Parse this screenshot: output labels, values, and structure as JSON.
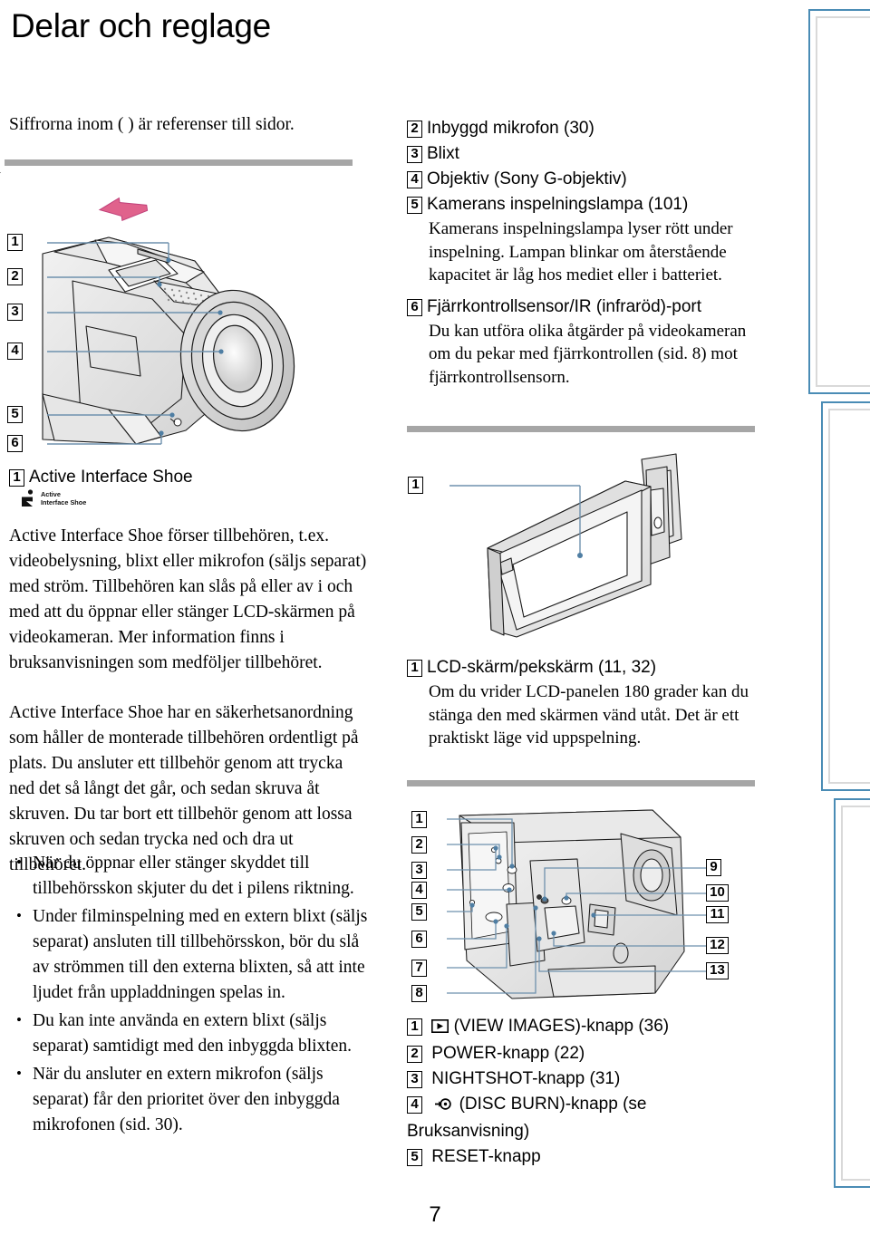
{
  "page": {
    "title": "Delar och reglage",
    "intro": "Siffrorna inom ( ) är referenser till sidor.",
    "page_number": "7"
  },
  "colors": {
    "rule": "#a6a6a6",
    "tab_border": "#4a8cb5",
    "leader": "#6e91ad",
    "arrow": "#e0628c"
  },
  "front_parts": [
    {
      "num": "2",
      "heading": "Inbyggd mikrofon (30)",
      "body": ""
    },
    {
      "num": "3",
      "heading": "Blixt",
      "body": ""
    },
    {
      "num": "4",
      "heading": "Objektiv (Sony G-objektiv)",
      "body": ""
    },
    {
      "num": "5",
      "heading": "Kamerans inspelningslampa (101)",
      "body": "Kamerans inspelningslampa lyser rött under inspelning. Lampan blinkar om återstående kapacitet är låg hos mediet eller i batteriet."
    },
    {
      "num": "6",
      "heading": "Fjärrkontrollsensor/IR (infraröd)-port",
      "body": "Du kan utföra olika åtgärder på videokameran om du pekar med fjärrkontrollen (sid. 8) mot fjärrkontrollsensorn."
    }
  ],
  "shoe_section": {
    "num": "1",
    "heading": "Active Interface Shoe",
    "logo_line1": "Active",
    "logo_line2": "Interface Shoe",
    "paragraphs": [
      "Active Interface Shoe förser tillbehören, t.ex. videobelysning, blixt eller mikrofon (säljs separat) med ström. Tillbehören kan slås på eller av i och med att du öppnar eller stänger LCD-skärmen på videokameran. Mer information finns i bruksanvisningen som medföljer tillbehöret.",
      "Active Interface Shoe har en säkerhetsanordning som håller de monterade tillbehören ordentligt på plats. Du ansluter ett tillbehör genom att trycka ned det så långt det går, och sedan skruva åt skruven. Du tar bort ett tillbehör genom att lossa skruven och sedan trycka ned och dra ut tillbehöret."
    ],
    "bullets": [
      "När du öppnar eller stänger skyddet till tillbehörsskon skjuter du det i pilens riktning.",
      "Under filminspelning med en extern blixt (säljs separat) ansluten till tillbehörsskon, bör du slå av strömmen till den externa blixten, så att inte ljudet från uppladdningen spelas in.",
      "Du kan inte använda en extern blixt (säljs separat) samtidigt med den inbyggda blixten.",
      "När du ansluter en extern mikrofon (säljs separat) får den prioritet över den inbyggda mikrofonen (sid. 30)."
    ]
  },
  "lcd_section": {
    "num": "1",
    "heading": "LCD-skärm/pekskärm (11, 32)",
    "body": "Om du vrider LCD-panelen 180 grader kan du stänga den med skärmen vänd utåt. Det är ett praktiskt läge vid uppspelning."
  },
  "bottom_parts": [
    {
      "num": "1",
      "icon": "play-icon",
      "heading": "(VIEW IMAGES)-knapp (36)"
    },
    {
      "num": "2",
      "icon": "",
      "heading": "POWER-knapp (22)"
    },
    {
      "num": "3",
      "icon": "",
      "heading": "NIGHTSHOT-knapp (31)"
    },
    {
      "num": "4",
      "icon": "disc-burn-icon",
      "heading": "(DISC BURN)-knapp (se Bruksanvisning)"
    },
    {
      "num": "5",
      "icon": "",
      "heading": "RESET-knapp"
    }
  ],
  "figures": {
    "front_camera": {
      "name": "front-camera-illustration",
      "callouts": [
        "1",
        "2",
        "3",
        "4",
        "5",
        "6"
      ]
    },
    "lcd_panel": {
      "name": "lcd-panel-illustration",
      "callouts": [
        "1"
      ]
    },
    "side_panel": {
      "name": "side-panel-illustration",
      "callouts_left": [
        "1",
        "2",
        "3",
        "4",
        "5",
        "6",
        "7",
        "8"
      ],
      "callouts_right": [
        "9",
        "10",
        "11",
        "12",
        "13"
      ]
    }
  }
}
